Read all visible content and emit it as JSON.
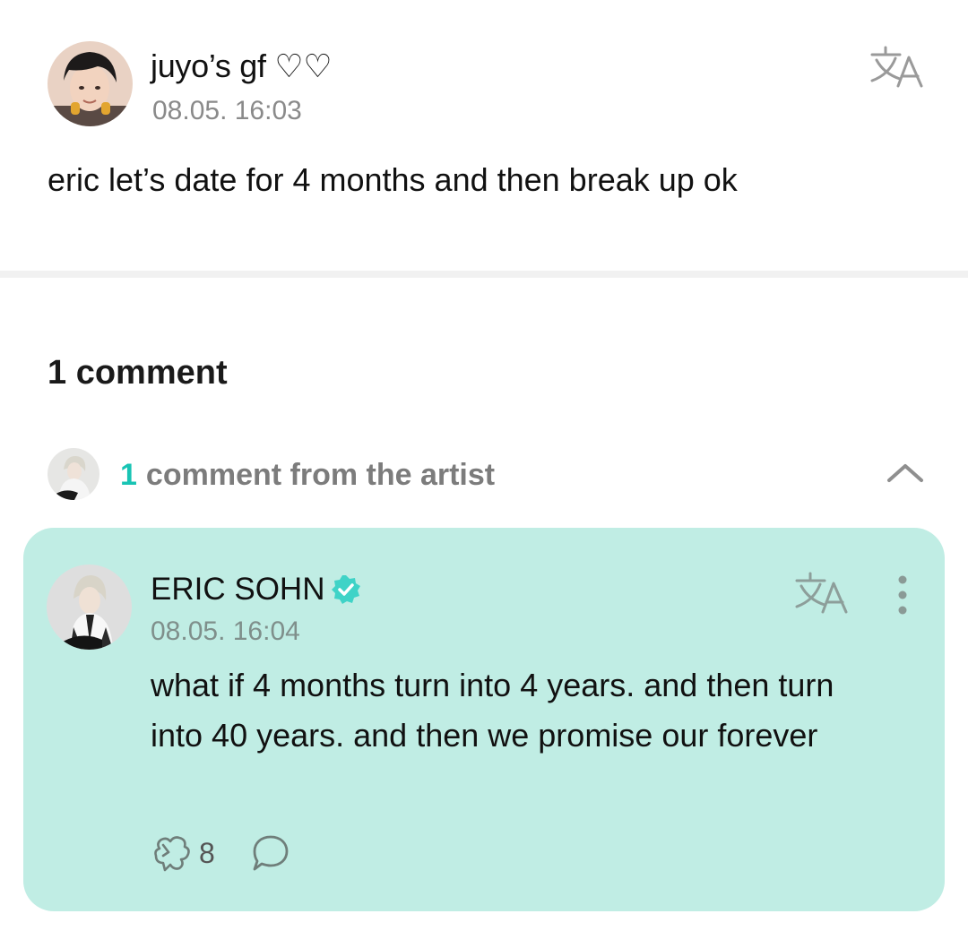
{
  "post": {
    "author": "juyo’s gf ♡♡",
    "timestamp": "08.05. 16:03",
    "body": "eric let’s date for 4 months and then break up ok",
    "translate_icon": "translate-icon"
  },
  "comments": {
    "count_label": "1 comment",
    "artist_summary": {
      "count": "1",
      "label": "comment from the artist",
      "toggle_icon": "chevron-up-icon"
    },
    "items": [
      {
        "author": "ERIC SOHN",
        "verified_icon": "verified-badge-icon",
        "timestamp": "08.05. 16:04",
        "body": " what if 4 months turn into 4 years. and then turn into 40 years. and then we promise our forever",
        "like_icon": "like-icon",
        "like_count": "8",
        "reply_icon": "reply-bubble-icon",
        "more_icon": "more-vertical-icon",
        "translate_icon": "translate-icon"
      }
    ]
  },
  "colors": {
    "card_background": "#c0ede4",
    "accent": "#18c4b4",
    "verified": "#3fd3c7",
    "muted_text": "#8a8a8a"
  }
}
